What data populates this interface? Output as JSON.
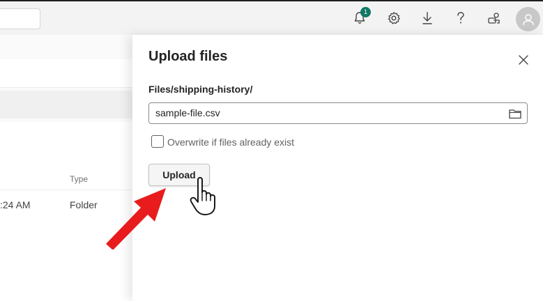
{
  "topbar": {
    "notification_count": "1",
    "icons": [
      "bell-icon",
      "gear-icon",
      "download-icon",
      "help-icon",
      "feedback-icon",
      "avatar-icon"
    ]
  },
  "background": {
    "column_type_header": "Type",
    "row": {
      "time": ":24 AM",
      "type": "Folder"
    }
  },
  "panel": {
    "title": "Upload files",
    "path": "Files/shipping-history/",
    "file_value": "sample-file.csv",
    "overwrite_label": "Overwrite if files already exist",
    "overwrite_checked": false,
    "upload_label": "Upload"
  },
  "colors": {
    "accent_badge": "#117865",
    "annotation_arrow": "#e81c1c"
  }
}
